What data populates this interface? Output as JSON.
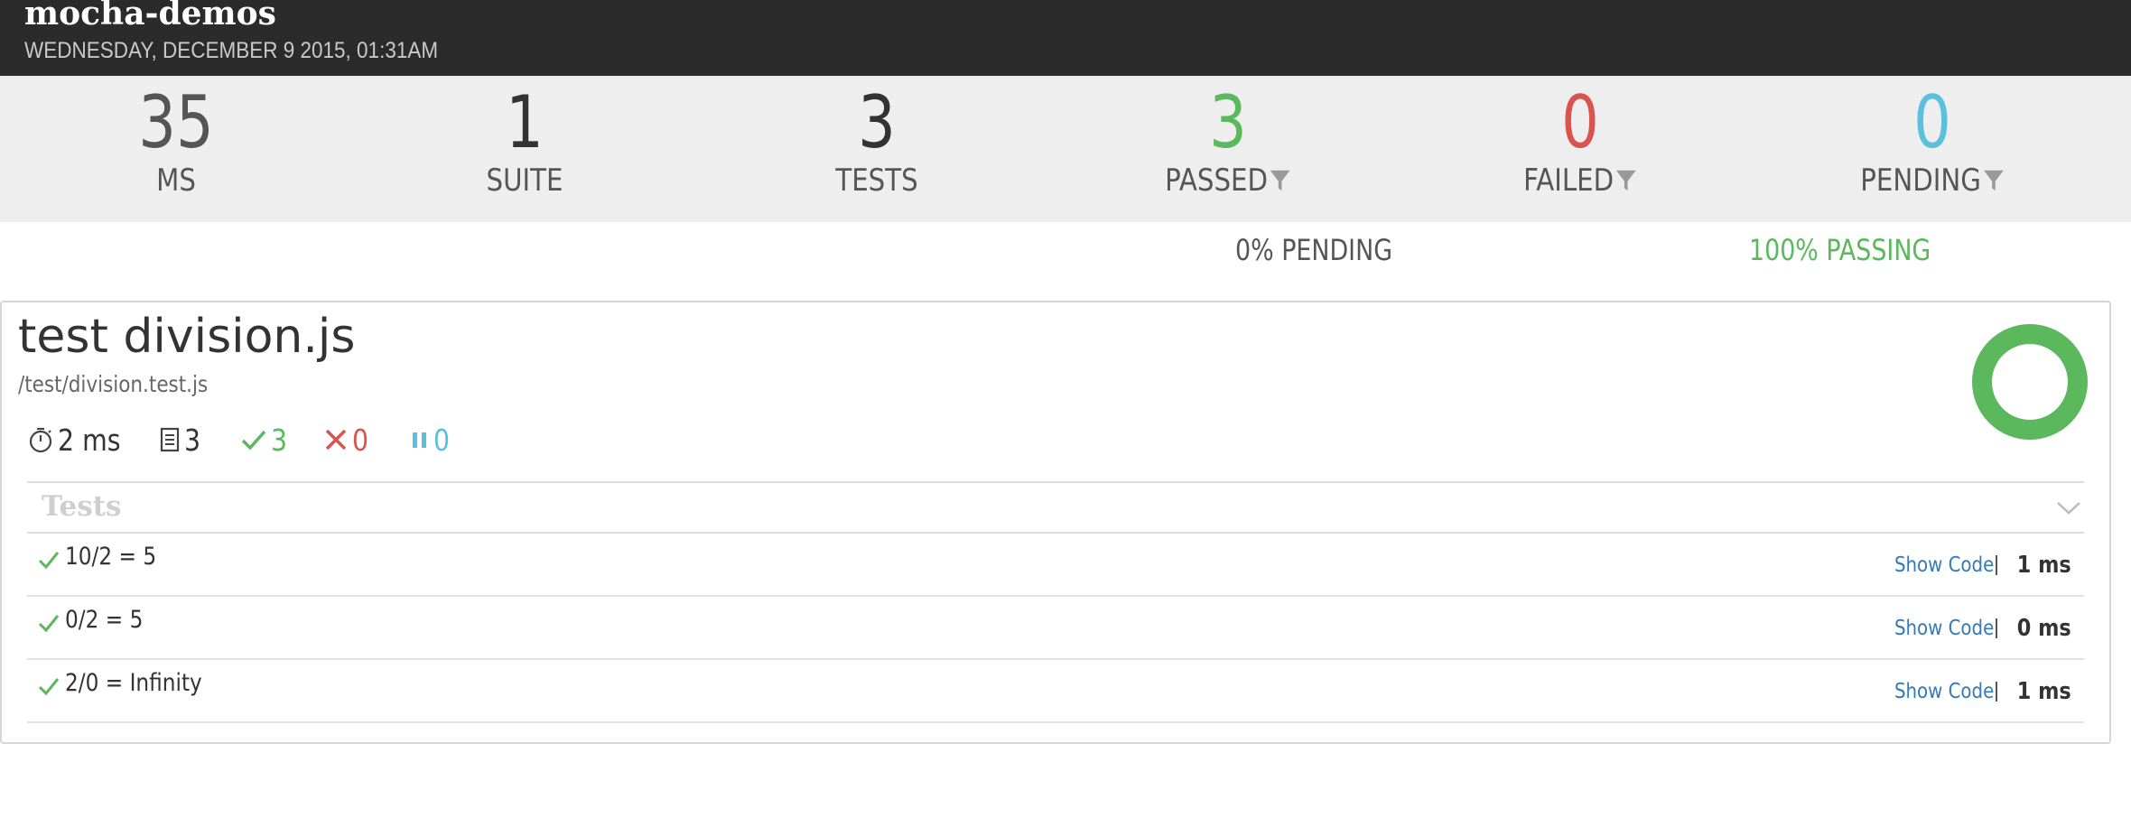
{
  "header": {
    "title": "mocha-demos",
    "date": "WEDNESDAY, DECEMBER 9 2015, 01:31AM"
  },
  "stats": [
    {
      "value": "35",
      "label": "MS",
      "color": "#555555",
      "filter": false
    },
    {
      "value": "1",
      "label": "SUITE",
      "color": "#333333",
      "filter": false
    },
    {
      "value": "3",
      "label": "TESTS",
      "color": "#333333",
      "filter": false
    },
    {
      "value": "3",
      "label": "PASSED",
      "color": "#5cb85c",
      "filter": true
    },
    {
      "value": "0",
      "label": "FAILED",
      "color": "#d9534f",
      "filter": true
    },
    {
      "value": "0",
      "label": "PENDING",
      "color": "#5bc0de",
      "filter": true
    }
  ],
  "summary": {
    "pending": "0% PENDING",
    "passing": "100% PASSING"
  },
  "suite": {
    "title": "test division.js",
    "file": "/test/division.test.js",
    "duration": "2 ms",
    "total": "3",
    "passed": "3",
    "failed": "0",
    "pending": "0",
    "pass_percent": 100,
    "tests_header": "Tests",
    "tests": [
      {
        "name": "10/2 = 5",
        "show_code": "Show Code",
        "duration": "1 ms"
      },
      {
        "name": "0/2 = 5",
        "show_code": "Show Code",
        "duration": "0 ms"
      },
      {
        "name": "2/0 = Infinity",
        "show_code": "Show Code",
        "duration": "1 ms"
      }
    ]
  },
  "colors": {
    "header_bg": "#2b2b2b",
    "stats_bg": "#eeeeee",
    "passed": "#5cb85c",
    "failed": "#d9534f",
    "pending": "#5bc0de",
    "link": "#337ab7"
  },
  "icons": {
    "stat_filter": "filter-icon",
    "duration": "stopwatch-icon",
    "total": "document-icon",
    "passed": "check-icon",
    "failed": "x-icon",
    "pending": "pause-icon",
    "tests_toggle": "chevron-down-icon",
    "test_status": "check-icon"
  }
}
